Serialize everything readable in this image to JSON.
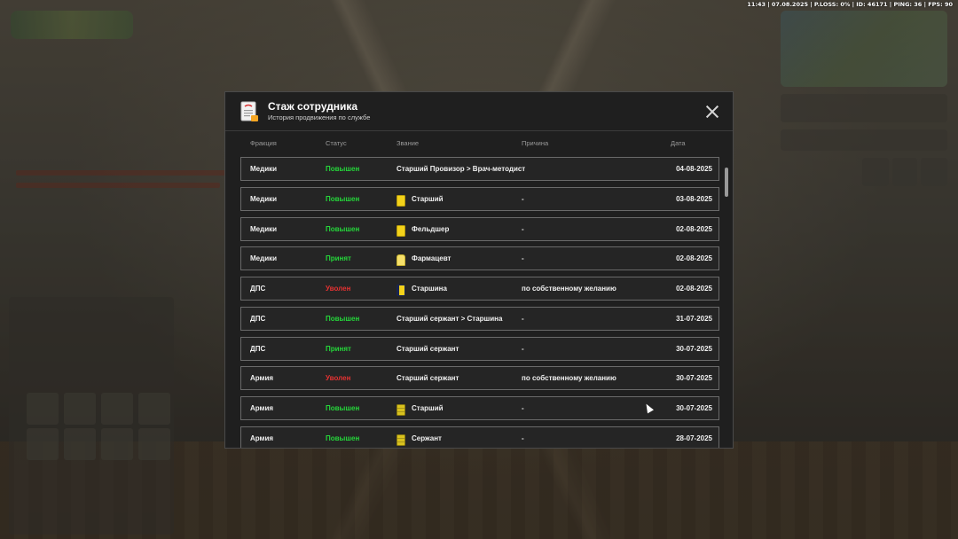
{
  "hud": {
    "status_line": "11:43 | 07.08.2025 | P.LOSS: 0% | ID: 46171 | PING: 36 | FPS: 90"
  },
  "modal": {
    "title": "Стаж сотрудника",
    "subtitle": "История продвижения по службе",
    "icon": "document-icon",
    "close_icon": "close-icon",
    "columns": {
      "faction": "Фракция",
      "status": "Статус",
      "rank": "Звание",
      "reason": "Причина",
      "date": "Дата"
    },
    "rows": [
      {
        "faction": "Медики",
        "status": "Повышен",
        "status_color": "#25d63a",
        "rank": "Старший Провизор > Врач-методист",
        "badge": "",
        "reason": "",
        "date": "04-08-2025"
      },
      {
        "faction": "Медики",
        "status": "Повышен",
        "status_color": "#25d63a",
        "rank": "Старший",
        "badge": "yellow",
        "reason": "-",
        "date": "03-08-2025"
      },
      {
        "faction": "Медики",
        "status": "Повышен",
        "status_color": "#25d63a",
        "rank": "Фельдшер",
        "badge": "yellow",
        "reason": "-",
        "date": "02-08-2025"
      },
      {
        "faction": "Медики",
        "status": "Принят",
        "status_color": "#25d63a",
        "rank": "Фармацевт",
        "badge": "pharma",
        "reason": "-",
        "date": "02-08-2025"
      },
      {
        "faction": "ДПС",
        "status": "Уволен",
        "status_color": "#e53232",
        "rank": "Старшина",
        "badge": "navy",
        "reason": "по собственному желанию",
        "date": "02-08-2025"
      },
      {
        "faction": "ДПС",
        "status": "Повышен",
        "status_color": "#25d63a",
        "rank": "Старший сержант > Старшина",
        "badge": "",
        "reason": "-",
        "date": "31-07-2025"
      },
      {
        "faction": "ДПС",
        "status": "Принят",
        "status_color": "#25d63a",
        "rank": "Старший сержант",
        "badge": "",
        "reason": "-",
        "date": "30-07-2025"
      },
      {
        "faction": "Армия",
        "status": "Уволен",
        "status_color": "#e53232",
        "rank": "Старший сержант",
        "badge": "",
        "reason": "по собственному желанию",
        "date": "30-07-2025"
      },
      {
        "faction": "Армия",
        "status": "Повышен",
        "status_color": "#25d63a",
        "rank": "Старший",
        "badge": "army",
        "reason": "-",
        "date": "30-07-2025"
      },
      {
        "faction": "Армия",
        "status": "Повышен",
        "status_color": "#25d63a",
        "rank": "Сержант",
        "badge": "army",
        "reason": "-",
        "date": "28-07-2025"
      }
    ]
  }
}
